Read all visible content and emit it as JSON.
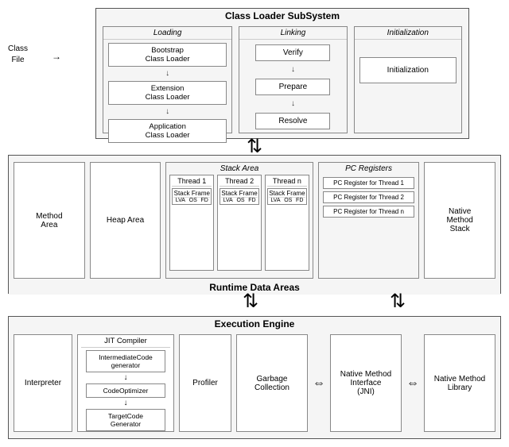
{
  "classLoaderSystem": {
    "title": "Class Loader SubSystem",
    "loading": {
      "label": "Loading",
      "loaders": [
        "Bootstrap\nClass Loader",
        "Extension\nClass Loader",
        "Application\nClass Loader"
      ]
    },
    "linking": {
      "label": "Linking",
      "items": [
        "Verify",
        "Prepare",
        "Resolve"
      ]
    },
    "initialization": {
      "label": "Initialization",
      "box": "Initialization"
    }
  },
  "classFile": {
    "line1": "Class",
    "line2": "File"
  },
  "runtimeDataAreas": {
    "title": "Runtime Data Areas",
    "methodArea": "Method\nArea",
    "heapArea": "Heap Area",
    "stackArea": {
      "label": "Stack Area",
      "threads": [
        {
          "name": "Thread 1",
          "frameLabel": "Stack Frame",
          "cols": [
            "LVA",
            "OS",
            "FD"
          ]
        },
        {
          "name": "Thread 2",
          "frameLabel": "Stack Frame",
          "cols": [
            "LVA",
            "OS",
            "FD"
          ]
        },
        {
          "name": "Thread n",
          "frameLabel": "Stack Frame",
          "cols": [
            "LVA",
            "OS",
            "FD"
          ]
        }
      ]
    },
    "pcRegisters": {
      "label": "PC Registers",
      "items": [
        "PC Register for Thread 1",
        "PC Register for Thread 2",
        "PC Register for Thread n"
      ]
    },
    "nativeMethodStack": "Native\nMethod\nStack"
  },
  "executionEngine": {
    "title": "Execution Engine",
    "interpreter": "Interpreter",
    "jit": {
      "label": "JIT Compiler",
      "steps": [
        "IntermediateCode\ngenerator",
        "CodeOptimizer",
        "TargetCode\nGenerator"
      ]
    },
    "profiler": "Profiler",
    "garbageCollection": "Garbage\nCollection",
    "jni": "Native Method\nInterface\n(JNI)",
    "nativeMethodLibrary": "Native Method\nLibrary"
  }
}
